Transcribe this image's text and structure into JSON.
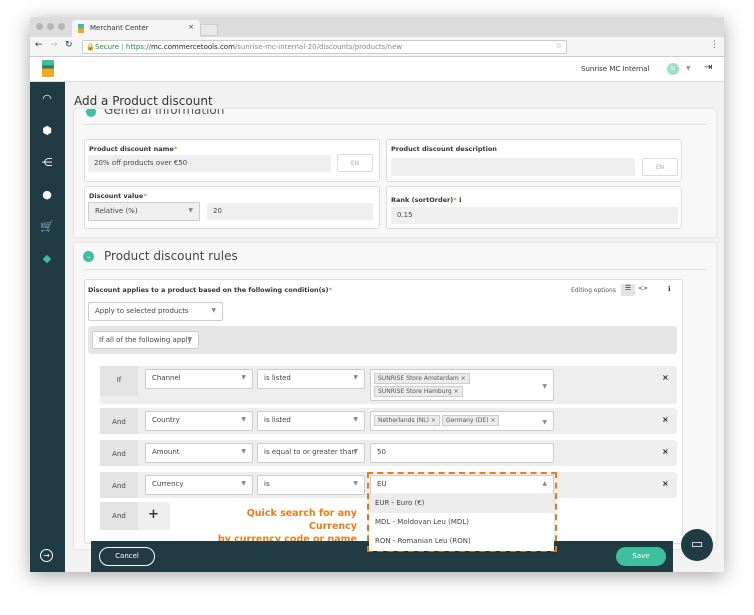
{
  "browser": {
    "tab_title": "Merchant Center",
    "secure_label": "Secure",
    "url_scheme": "https://",
    "url_host": "mc.commercetools.com",
    "url_path": "/sunrise-mc-internal-20/discounts/products/new"
  },
  "header": {
    "project": "Sunrise MC Internal",
    "avatar": "SI"
  },
  "sidebar": {
    "items": [
      {
        "icon": "dashboard-icon"
      },
      {
        "icon": "box-icon"
      },
      {
        "icon": "categories-icon"
      },
      {
        "icon": "customer-icon"
      },
      {
        "icon": "cart-icon"
      },
      {
        "icon": "discount-icon"
      }
    ],
    "expand_icon": "arrow-right-icon"
  },
  "page": {
    "title": "Add a Product discount"
  },
  "general": {
    "title": "General information",
    "name_label": "Product discount name",
    "name_value": "20% off products over €50",
    "lang": "EN",
    "desc_label": "Product discount description",
    "desc_value": "",
    "value_label": "Discount value",
    "value_type": "Relative (%)",
    "value_amount": "20",
    "rank_label": "Rank (sortOrder)",
    "rank_value": "0.15"
  },
  "rules": {
    "title": "Product discount rules",
    "condition_label": "Discount applies to a product based on the following condition(s)",
    "editing_options": "Editing options",
    "apply_select": "Apply to selected products",
    "group_select": "If all of the following apply",
    "conditions": [
      {
        "prefix": "If",
        "field": "Channel",
        "op": "is listed",
        "chips": [
          "SUNRISE Store Amsterdam",
          "SUNRISE Store Hamburg"
        ]
      },
      {
        "prefix": "And",
        "field": "Country",
        "op": "is listed",
        "chips": [
          "Netherlands (NL)",
          "Germany (DE)"
        ]
      },
      {
        "prefix": "And",
        "field": "Amount",
        "op": "is equal to or greater than",
        "value": "50"
      },
      {
        "prefix": "And",
        "field": "Currency",
        "op": "is",
        "value": "EU"
      }
    ],
    "add_prefix": "And",
    "currency_options": [
      "EUR - Euro (€)",
      "MDL - Moldovan Leu (MDL)",
      "RON - Romanian Leu (RON)"
    ]
  },
  "annotation": {
    "line1": "Quick search for any Currency",
    "line2": "by currency code or name",
    "color": "#f07b17"
  },
  "footer": {
    "cancel": "Cancel",
    "save": "Save"
  },
  "colors": {
    "sidebar": "#213b45",
    "accent": "#3fbfa0"
  }
}
